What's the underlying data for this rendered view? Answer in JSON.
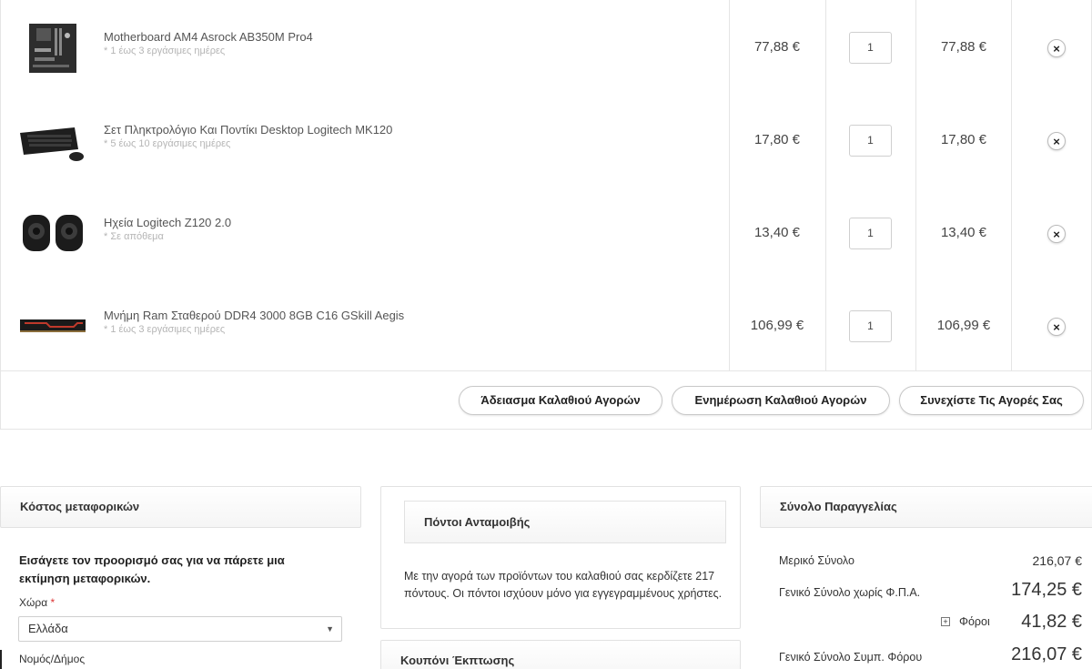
{
  "cart": {
    "items": [
      {
        "name": "Motherboard AM4 Asrock AB350M Pro4",
        "availability": "* 1 έως 3 εργάσιμες ημέρες",
        "price": "77,88 €",
        "qty": "1",
        "total": "77,88 €",
        "thumb_icon": "motherboard-image"
      },
      {
        "name": "Σετ Πληκτρολόγιο Και Ποντίκι Desktop Logitech MK120",
        "availability": "* 5 έως 10 εργάσιμες ημέρες",
        "price": "17,80 €",
        "qty": "1",
        "total": "17,80 €",
        "thumb_icon": "keyboard-mouse-image"
      },
      {
        "name": "Ηχεία Logitech Z120 2.0",
        "availability": "* Σε απόθεμα",
        "price": "13,40 €",
        "qty": "1",
        "total": "13,40 €",
        "thumb_icon": "speakers-image"
      },
      {
        "name": "Μνήμη Ram Σταθερού DDR4 3000 8GB C16 GSkill Aegis",
        "availability": "* 1 έως 3 εργάσιμες ημέρες",
        "price": "106,99 €",
        "qty": "1",
        "total": "106,99 €",
        "thumb_icon": "ram-image"
      }
    ],
    "remove_icon": "close-icon",
    "buttons": {
      "empty": "Άδειασμα Καλαθιού Αγορών",
      "update": "Ενημέρωση Καλαθιού Αγορών",
      "continue": "Συνεχίστε Τις Αγορές Σας"
    }
  },
  "shipping": {
    "title": "Κόστος μεταφορικών",
    "intro": "Εισάγετε τον προορισμό σας για να πάρετε μια εκτίμηση μεταφορικών.",
    "country_label": "Χώρα",
    "required_mark": "*",
    "country_value": "Ελλάδα",
    "region_label": "Νομός/Δήμος"
  },
  "reward": {
    "title": "Πόντοι Ανταμοιβής",
    "text": "Με την αγορά των προϊόντων του καλαθιού σας κερδίζετε 217 πόντους. Οι πόντοι ισχύουν μόνο για εγγεγραμμένους χρήστες."
  },
  "coupon": {
    "title": "Κουπόνι Έκπτωσης"
  },
  "summary": {
    "title": "Σύνολο Παραγγελίας",
    "subtotal_label": "Μερικό Σύνολο",
    "subtotal_value": "216,07 €",
    "net_label": "Γενικό Σύνολο χωρίς Φ.Π.Α.",
    "net_value": "174,25 €",
    "tax_label": "Φόροι",
    "tax_value": "41,82 €",
    "grand_label": "Γενικό Σύνολο Συμπ. Φόρου",
    "grand_value": "216,07 €"
  },
  "colors": {
    "border": "#e5e5e5",
    "text": "#333333",
    "muted": "#b5b5b5",
    "required": "#dd3333"
  }
}
